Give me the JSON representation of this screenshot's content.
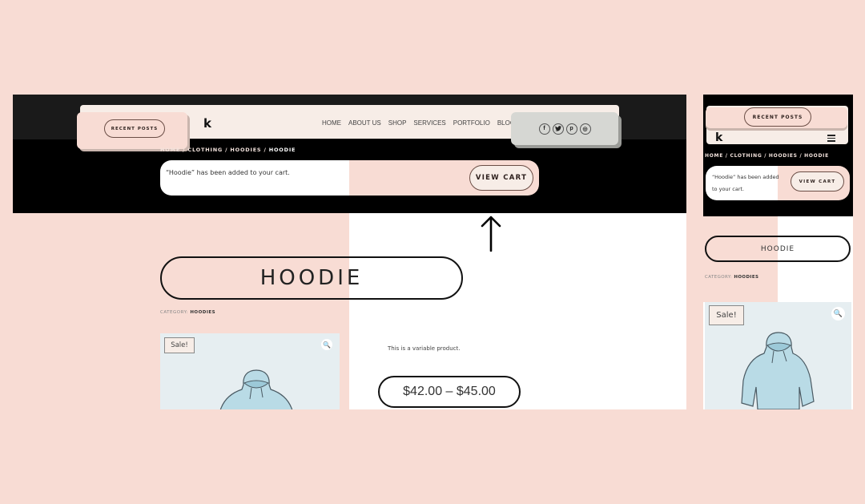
{
  "desktop": {
    "recent_posts_label": "RECENT POSTS",
    "logo": "k",
    "nav": [
      "HOME",
      "ABOUT US",
      "SHOP",
      "SERVICES",
      "PORTFOLIO",
      "BLOG"
    ],
    "social_icons": [
      {
        "name": "facebook-icon",
        "glyph": "f"
      },
      {
        "name": "twitter-icon",
        "glyph": "t"
      },
      {
        "name": "pinterest-icon",
        "glyph": "p"
      },
      {
        "name": "instagram-icon",
        "glyph": "◎"
      }
    ],
    "breadcrumb": {
      "items": [
        "HOME",
        "CLOTHING",
        "HOODIES"
      ],
      "separator": " / ",
      "current": "HOODIE"
    },
    "notice": {
      "message": "“Hoodie” has been added to your cart.",
      "button_label": "VIEW CART"
    },
    "product": {
      "title": "HOODIE",
      "category_label": "CATEGORY:",
      "category_value": "HOODIES",
      "sale_badge": "Sale!",
      "zoom_icon": "🔍",
      "description": "This is a variable product.",
      "price": "$42.00 – $45.00"
    }
  },
  "mobile": {
    "recent_posts_label": "RECENT POSTS",
    "logo": "k",
    "breadcrumb": "HOME / CLOTHING / HOODIES / HOODIE",
    "notice": {
      "message": "“Hoodie” has been added to your cart.",
      "button_label": "VIEW CART"
    },
    "product": {
      "title": "HOODIE",
      "category_label": "CATEGORY:",
      "category_value": "HOODIES",
      "sale_badge": "Sale!",
      "zoom_icon": "🔍"
    }
  },
  "colors": {
    "page_bg": "#f8dcd4",
    "blush": "#f8dcd4",
    "cream": "#f7ede7",
    "dark": "#000000",
    "social_card": "#d6d7d3",
    "image_bg": "#e6eef1"
  }
}
